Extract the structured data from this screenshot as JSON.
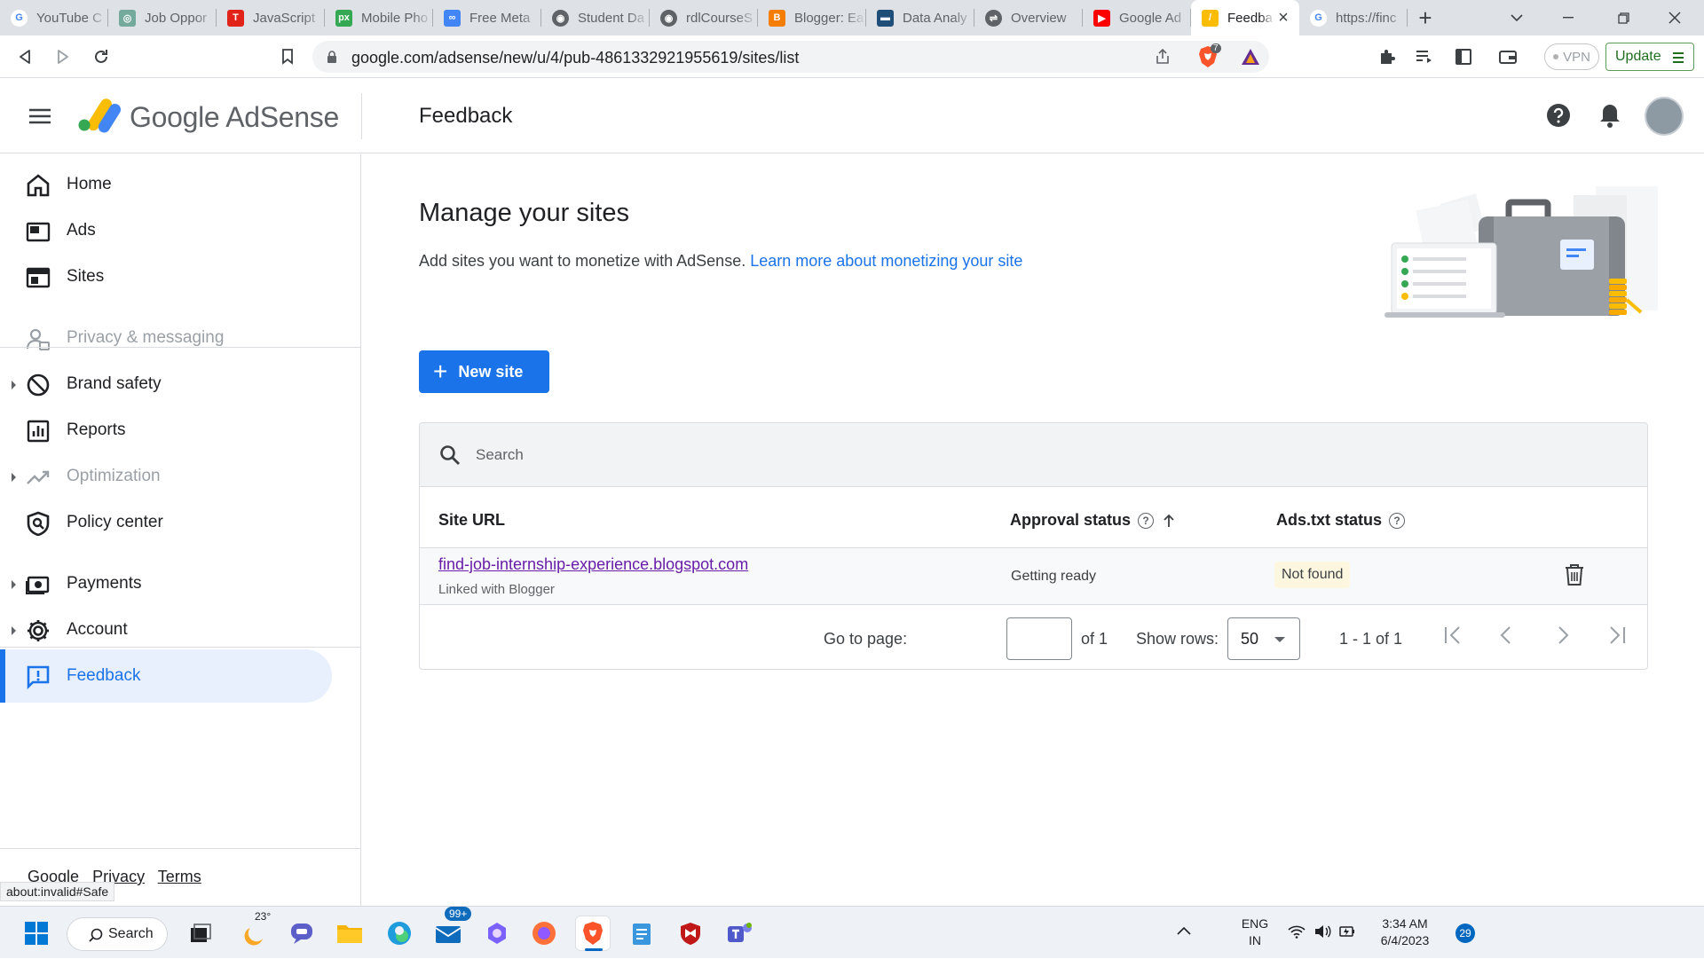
{
  "browser": {
    "tabs": [
      {
        "title": "YouTube C",
        "icon": "google-icon",
        "color": "#ffffff"
      },
      {
        "title": "Job Oppor",
        "icon": "chatgpt-icon",
        "color": "#74aa9c"
      },
      {
        "title": "JavaScript",
        "icon": "t-icon",
        "color": "#e2231a"
      },
      {
        "title": "Mobile Pho",
        "icon": "px-icon",
        "color": "#34a853"
      },
      {
        "title": "Free Meta",
        "icon": "link-icon",
        "color": "#4285f4"
      },
      {
        "title": "Student Da",
        "icon": "globe-icon",
        "color": "#5f6368"
      },
      {
        "title": "rdlCourseS",
        "icon": "globe-icon",
        "color": "#5f6368"
      },
      {
        "title": "Blogger: Ea",
        "icon": "blogger-icon",
        "color": "#f57d00"
      },
      {
        "title": "Data Analy",
        "icon": "data-icon",
        "color": "#1f4e79"
      },
      {
        "title": "Overview",
        "icon": "filter-icon",
        "color": "#5f6368"
      },
      {
        "title": "Google Ad",
        "icon": "youtube-icon",
        "color": "#ff0000"
      },
      {
        "title": "Feedba",
        "icon": "adsense-icon",
        "color": "#fbbc04",
        "active": true
      },
      {
        "title": "https://finc",
        "icon": "google-icon",
        "color": "#ffffff"
      }
    ],
    "url": "google.com/adsense/new/u/4/pub-4861332921955619/sites/list",
    "brave_badge": "7",
    "vpn_label": "VPN",
    "update_label": "Update",
    "status_url": "about:invalid#Safe"
  },
  "header": {
    "brand": "Google AdSense",
    "section_title": "Feedback"
  },
  "sidebar": {
    "items": [
      {
        "label": "Home",
        "icon": "home-icon"
      },
      {
        "label": "Ads",
        "icon": "ads-icon"
      },
      {
        "label": "Sites",
        "icon": "sites-icon"
      },
      {
        "label": "Privacy & messaging",
        "icon": "privacy-icon",
        "disabled": true
      },
      {
        "label": "Brand safety",
        "icon": "block-icon",
        "expandable": true
      },
      {
        "label": "Reports",
        "icon": "reports-icon"
      },
      {
        "label": "Optimization",
        "icon": "trend-icon",
        "disabled": true,
        "expandable": true
      },
      {
        "label": "Policy center",
        "icon": "policy-icon"
      },
      {
        "label": "Payments",
        "icon": "payments-icon",
        "expandable": true
      },
      {
        "label": "Account",
        "icon": "gear-icon",
        "expandable": true
      },
      {
        "label": "Feedback",
        "icon": "feedback-icon",
        "active": true
      }
    ],
    "footer": {
      "google": "Google",
      "privacy": "Privacy",
      "terms": "Terms"
    }
  },
  "main": {
    "title": "Manage your sites",
    "description": "Add sites you want to monetize with AdSense.",
    "learn_more": "Learn more about monetizing your site",
    "new_site_label": "New site",
    "search_placeholder": "Search",
    "columns": {
      "site_url": "Site URL",
      "approval_status": "Approval status",
      "ads_txt_status": "Ads.txt status"
    },
    "rows": [
      {
        "site_url": "find-job-internship-experience.blogspot.com",
        "linked": "Linked with Blogger",
        "approval_status": "Getting ready",
        "ads_txt_status": "Not found"
      }
    ],
    "pagination": {
      "go_to_page_label": "Go to page:",
      "go_to_page_value": "",
      "of_pages": "of 1",
      "show_rows_label": "Show rows:",
      "rows_value": "50",
      "range": "1 - 1 of 1"
    }
  },
  "taskbar": {
    "search_label": "Search",
    "weather_temp": "23°",
    "mail_badge": "99+",
    "language": "ENG",
    "region": "IN",
    "time": "3:34 AM",
    "date": "6/4/2023",
    "notification_count": "29"
  },
  "colors": {
    "accent": "#1a73e8",
    "link_visited": "#681da8",
    "active_nav_bg": "#e8f0fe"
  }
}
